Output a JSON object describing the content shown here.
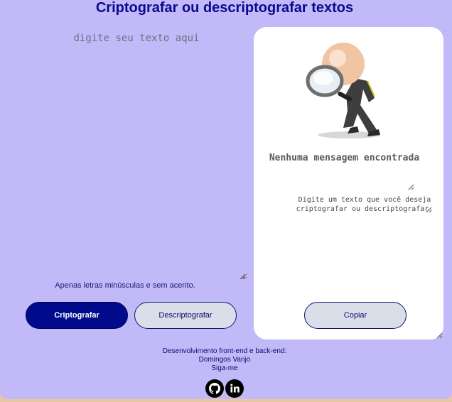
{
  "header": {
    "title": "Criptografar ou descriptografar textos"
  },
  "editor": {
    "placeholder": "digite seu texto aqui",
    "hint": "Apenas letras minúsculas e sem acento."
  },
  "actions": {
    "encrypt_label": "Criptografar",
    "decrypt_label": "Descriptografar"
  },
  "result_panel": {
    "illustration_icon": "magnifying-glass-figure-icon",
    "title": "Nenhuma mensagem encontrada",
    "description": "Digite um texto que você deseja criptografar ou descriptografar.",
    "copy_label": "Copiar"
  },
  "footer": {
    "credit_line": "Desenvolvimento front-end e back-end:",
    "author": "Domingos Vanjo",
    "follow": "Siga-me",
    "social_icons": [
      "github-icon",
      "linkedin-icon"
    ]
  },
  "colors": {
    "background": "#c2b9f9",
    "primary": "#000a8a",
    "title": "#0a0a8c",
    "panel": "#ffffff",
    "secondary_button": "#d9dee8"
  }
}
